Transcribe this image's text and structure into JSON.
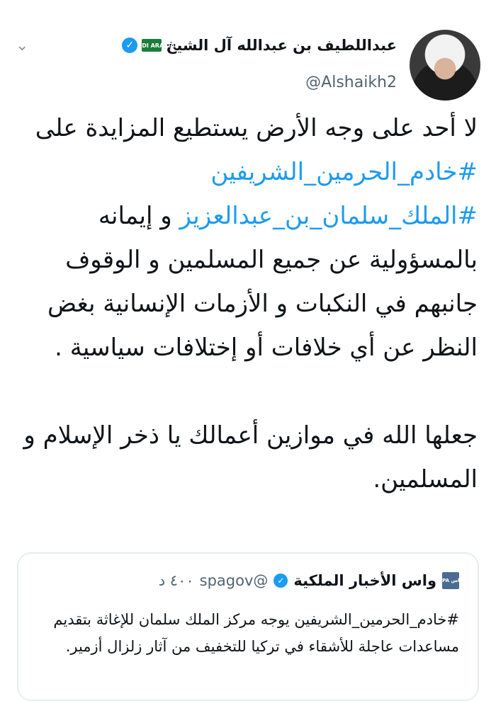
{
  "author": {
    "name": "عبداللطيف بن عبدالله آل الشيخ",
    "handle": "@Alshaikh2",
    "flag_label": "SAUDI ARABIA"
  },
  "tweet": {
    "lines": [
      "لا أحد على وجه الأرض يستطيع المزايدة",
      "على",
      "#خادم_الحرمين_الشريفين",
      "#الملك_سلمان_بن_عبدالعزيز",
      "و إيمانه بالمسؤولية عن جميع المسلمين و الوقوف جانبهم في النكبات و الأزمات الإنسانية بغض النظر عن أي خلافات أو إختلافات سياسية .",
      "جعلها الله في موازين أعمالك يا ذخر الإسلام و المسلمين."
    ]
  },
  "quote": {
    "logo_text": "واس SPA",
    "name": "واس الأخبار الملكية",
    "handle": "@spagov",
    "time": "٤٠٠ د",
    "text": "#خادم_الحرمين_الشريفين يوجه مركز الملك سلمان للإغاثة بتقديم مساعدات عاجلة للأشقاء في تركيا للتخفيف من آثار زلزال أزمير."
  },
  "icons": {
    "verified": "verified-badge-icon",
    "menu": "chevron-down-icon"
  },
  "colors": {
    "link": "#1d9bf0",
    "text": "#0f1419",
    "muted": "#536471"
  }
}
